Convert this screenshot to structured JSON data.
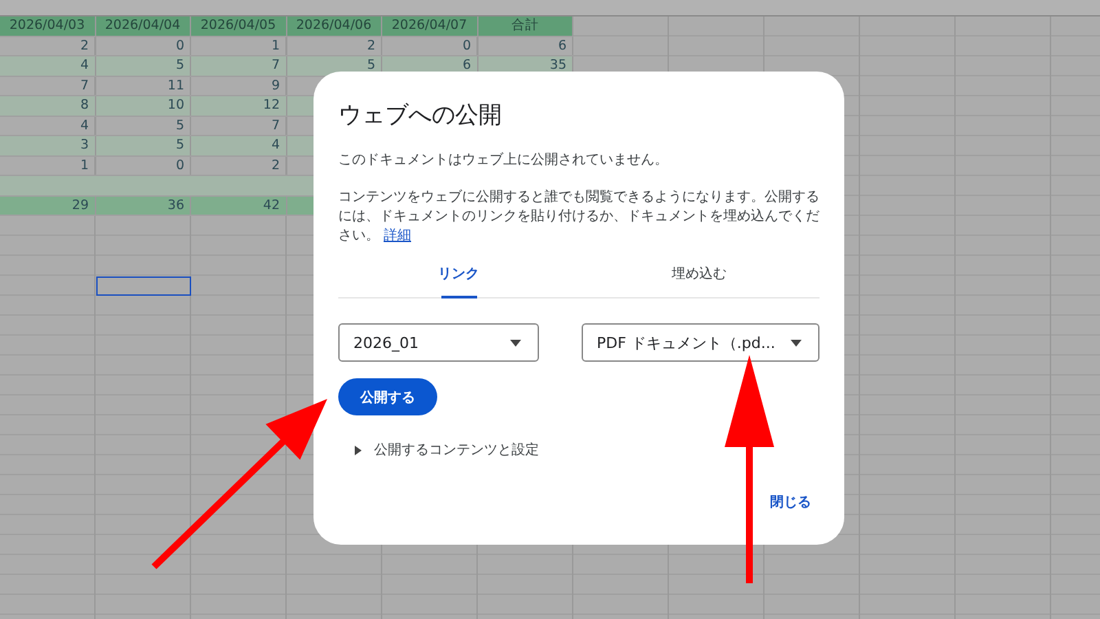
{
  "sheet": {
    "header_row": [
      "2026/04/03",
      "2026/04/04",
      "2026/04/05",
      "2026/04/06",
      "2026/04/07",
      "合計"
    ],
    "rows": [
      {
        "kind": "plain",
        "cells": [
          "2",
          "0",
          "1",
          "2",
          "0",
          "6"
        ]
      },
      {
        "kind": "banded",
        "cells": [
          "4",
          "5",
          "7",
          "5",
          "6",
          "35"
        ]
      },
      {
        "kind": "plain",
        "cells": [
          "7",
          "11",
          "9"
        ]
      },
      {
        "kind": "banded",
        "cells": [
          "8",
          "10",
          "12"
        ]
      },
      {
        "kind": "plain",
        "cells": [
          "4",
          "5",
          "7"
        ]
      },
      {
        "kind": "banded",
        "cells": [
          "3",
          "5",
          "4"
        ]
      },
      {
        "kind": "plain",
        "cells": [
          "1",
          "0",
          "2"
        ]
      },
      {
        "kind": "banded",
        "cells": []
      },
      {
        "kind": "total",
        "cells": [
          "29",
          "36",
          "42"
        ]
      }
    ]
  },
  "dialog": {
    "title": "ウェブへの公開",
    "status": "このドキュメントはウェブ上に公開されていません。",
    "description": "コンテンツをウェブに公開すると誰でも閲覧できるようになります。公開するには、ドキュメントのリンクを貼り付けるか、ドキュメントを埋め込んでください。",
    "link": "詳細",
    "tabs": [
      {
        "label": "リンク",
        "selected": true
      },
      {
        "label": "埋め込む",
        "selected": false
      }
    ],
    "dropdowns": [
      {
        "value": "2026_01"
      },
      {
        "value": "PDF ドキュメント（.pd..."
      }
    ],
    "publish_button": "公開する",
    "expander": {
      "label": "公開するコンテンツと設定",
      "expanded": false
    },
    "close_button": "閉じる"
  }
}
